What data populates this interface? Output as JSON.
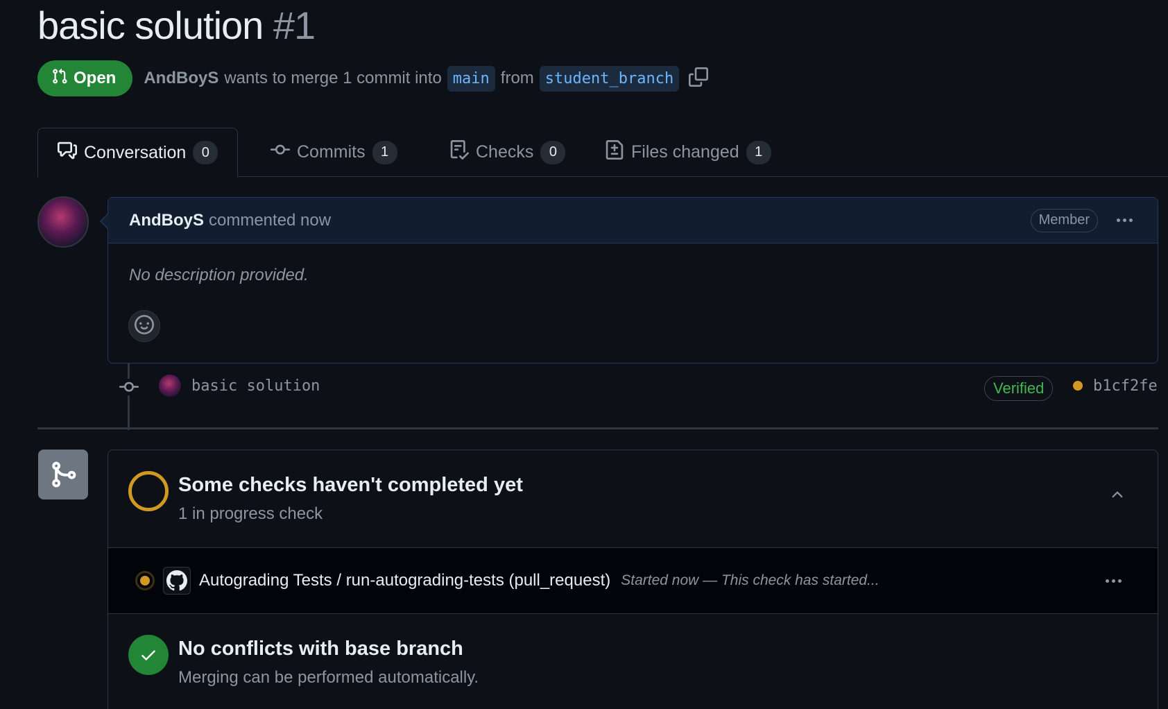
{
  "pr": {
    "title": "basic solution",
    "number": "#1",
    "state": "Open",
    "author": "AndBoyS",
    "merge_text": "wants to merge 1 commit into",
    "base_branch": "main",
    "from_text": "from",
    "head_branch": "student_branch"
  },
  "tabs": [
    {
      "label": "Conversation",
      "count": "0",
      "icon": "comment-discussion-icon"
    },
    {
      "label": "Commits",
      "count": "1",
      "icon": "git-commit-icon"
    },
    {
      "label": "Checks",
      "count": "0",
      "icon": "checklist-icon"
    },
    {
      "label": "Files changed",
      "count": "1",
      "icon": "file-diff-icon"
    }
  ],
  "comment": {
    "author": "AndBoyS",
    "action": "commented now",
    "role_badge": "Member",
    "body": "No description provided."
  },
  "commit": {
    "message": "basic solution",
    "verified": "Verified",
    "sha": "b1cf2fe",
    "status_color": "#d29922"
  },
  "checks": {
    "title": "Some checks haven't completed yet",
    "subtitle": "1 in progress check",
    "items": [
      {
        "name": "Autograding Tests / run-autograding-tests (pull_request)",
        "description": "Started now — This check has started..."
      }
    ]
  },
  "merge": {
    "title": "No conflicts with base branch",
    "subtitle": "Merging can be performed automatically."
  },
  "colors": {
    "background": "#0d1117",
    "open_green": "#238636",
    "pending_yellow": "#d29922",
    "link_blue": "#6cb6ff"
  }
}
